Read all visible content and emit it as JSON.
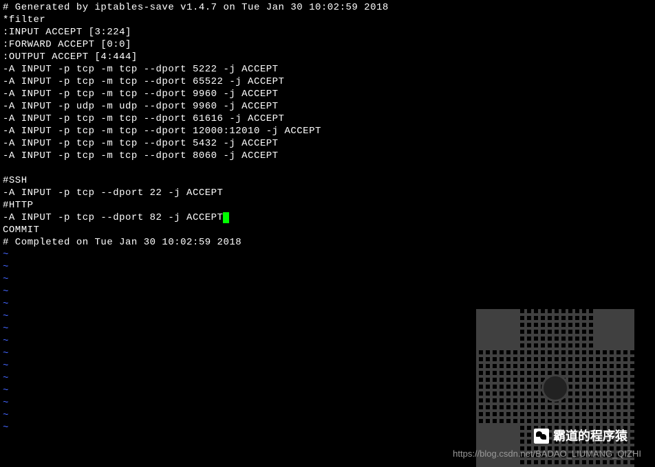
{
  "terminal": {
    "lines": [
      "# Generated by iptables-save v1.4.7 on Tue Jan 30 10:02:59 2018",
      "*filter",
      ":INPUT ACCEPT [3:224]",
      ":FORWARD ACCEPT [0:0]",
      ":OUTPUT ACCEPT [4:444]",
      "-A INPUT -p tcp -m tcp --dport 5222 -j ACCEPT",
      "-A INPUT -p tcp -m tcp --dport 65522 -j ACCEPT",
      "-A INPUT -p tcp -m tcp --dport 9960 -j ACCEPT",
      "-A INPUT -p udp -m udp --dport 9960 -j ACCEPT",
      "-A INPUT -p tcp -m tcp --dport 61616 -j ACCEPT",
      "-A INPUT -p tcp -m tcp --dport 12000:12010 -j ACCEPT",
      "-A INPUT -p tcp -m tcp --dport 5432 -j ACCEPT",
      "-A INPUT -p tcp -m tcp --dport 8060 -j ACCEPT",
      "",
      "#SSH",
      "-A INPUT -p tcp --dport 22 -j ACCEPT",
      "#HTTP",
      "-A INPUT -p tcp --dport 82 -j ACCEPT",
      "COMMIT",
      "# Completed on Tue Jan 30 10:02:59 2018"
    ],
    "cursor_line_index": 17,
    "tilde_count": 15
  },
  "watermark": {
    "title": "霸道的程序猿",
    "link": "https://blog.csdn.net/BADAO_LIUMANG_QIZHI"
  }
}
